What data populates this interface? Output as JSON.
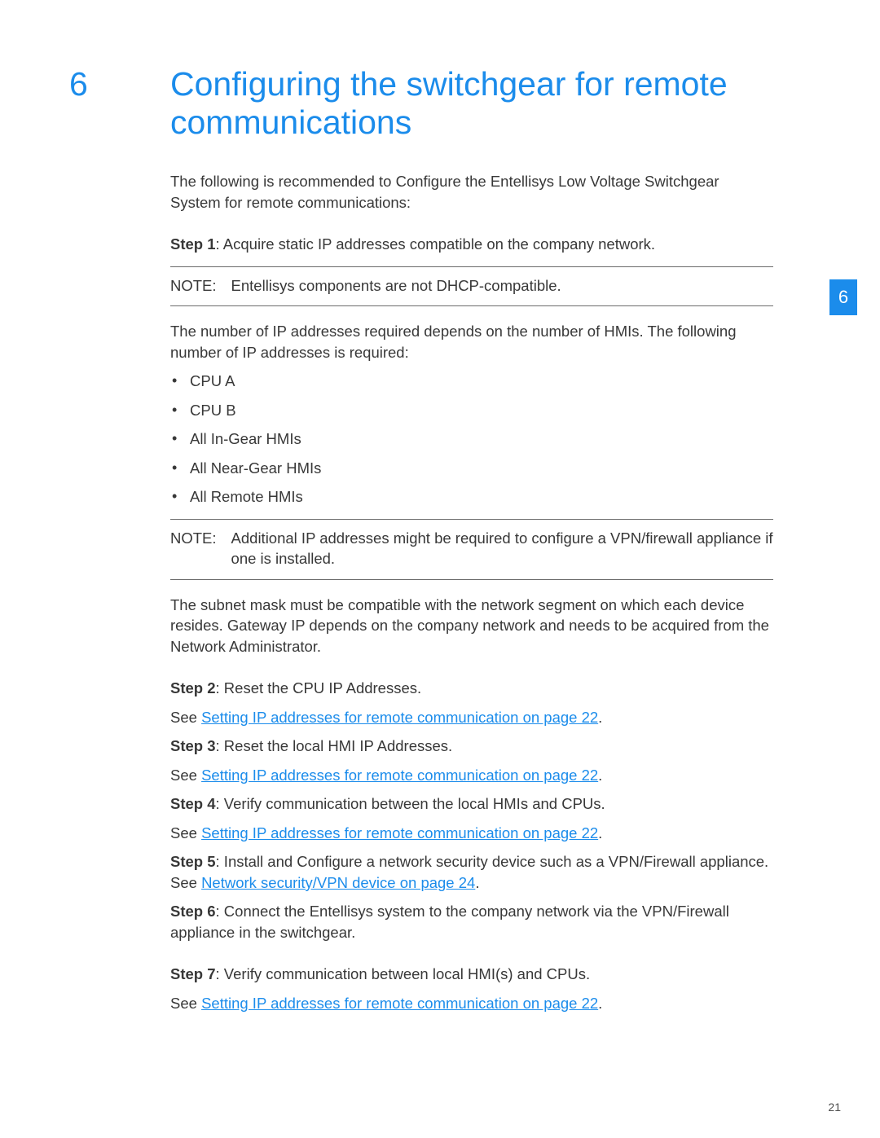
{
  "chapter": {
    "number": "6",
    "title": "Configuring the switchgear for remote communications",
    "side_tab": "6"
  },
  "intro": "The following is recommended to Configure the Entellisys Low Voltage Switchgear System for remote communications:",
  "step1": {
    "label": "Step 1",
    "text": ": Acquire static IP addresses compatible on the company network."
  },
  "note1": {
    "label": "NOTE:",
    "text": "Entellisys components are not DHCP-compatible."
  },
  "ip_count_intro": "The number of IP addresses required depends on the number of HMIs. The following number of IP addresses is required:",
  "ip_list": [
    "CPU A",
    "CPU B",
    "All In-Gear HMIs",
    "All Near-Gear HMIs",
    "All Remote HMIs"
  ],
  "note2": {
    "label": "NOTE:",
    "text": "Additional IP addresses might be required to configure a VPN/firewall appliance if one is installed."
  },
  "subnet_para": "The subnet mask must be compatible with the network segment on which each device resides. Gateway IP depends on the company network and needs to be acquired from the Network Administrator.",
  "step2": {
    "label": "Step 2",
    "text": ": Reset the CPU IP Addresses."
  },
  "see_prefix": "See ",
  "xref_ip": "Setting IP addresses for remote communication on page 22",
  "step3": {
    "label": "Step 3",
    "text": ": Reset the local HMI IP Addresses."
  },
  "step4": {
    "label": "Step 4",
    "text": ": Verify communication between the local HMIs and CPUs."
  },
  "step5": {
    "label": "Step 5",
    "text_before": ": Install and Configure a network security device such as a VPN/Firewall appliance. See ",
    "xref": "Network security/VPN device on page 24"
  },
  "step6": {
    "label": "Step 6",
    "text": ": Connect the Entellisys system to the company network via the VPN/Firewall appliance in the switchgear."
  },
  "step7": {
    "label": "Step 7",
    "text": ": Verify communication between local HMI(s) and CPUs."
  },
  "period": ".",
  "page_number": "21"
}
